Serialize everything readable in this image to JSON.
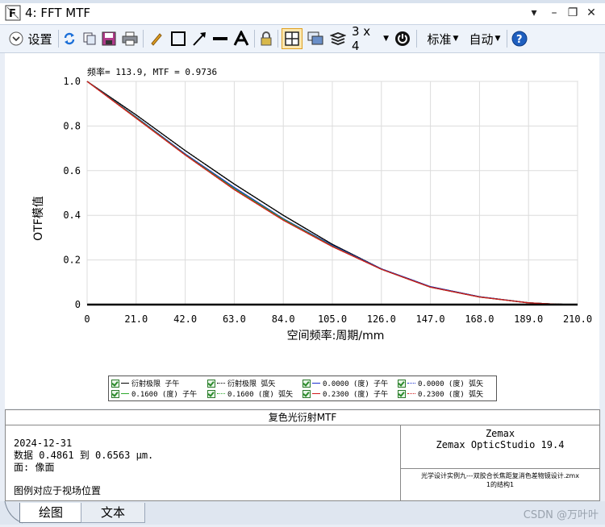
{
  "window": {
    "title": "4: FFT MTF",
    "controls": [
      "minimize",
      "restore",
      "close"
    ]
  },
  "toolbar": {
    "settings_label": "设置",
    "layout_label": "3 x 4",
    "standard_label": "标准",
    "auto_label": "自动"
  },
  "plot": {
    "cursor_readout": "频率= 113.9, MTF = 0.9736",
    "ylabel": "OTF模值",
    "xlabel": "空间频率:周期/mm"
  },
  "chart_data": {
    "type": "line",
    "xlabel": "空间频率:周期/mm",
    "ylabel": "OTF模值",
    "xlim": [
      0,
      210
    ],
    "ylim": [
      0,
      1
    ],
    "x_ticks": [
      "0",
      "21.0",
      "42.0",
      "63.0",
      "84.0",
      "105.0",
      "126.0",
      "147.0",
      "168.0",
      "189.0",
      "210.0"
    ],
    "y_ticks": [
      "0",
      "0.2",
      "0.4",
      "0.6",
      "0.8",
      "1.0"
    ],
    "grid": true,
    "x": [
      0,
      21,
      42,
      63,
      84,
      105,
      126,
      147,
      168,
      189,
      200,
      210
    ],
    "series": [
      {
        "name": "衍射极限 子午",
        "color": "#000000",
        "style": "solid",
        "values": [
          1.0,
          0.85,
          0.69,
          0.54,
          0.4,
          0.27,
          0.16,
          0.08,
          0.035,
          0.008,
          0.002,
          0.0
        ]
      },
      {
        "name": "衍射极限 弧矢",
        "color": "#000000",
        "style": "dotted",
        "values": [
          1.0,
          0.85,
          0.69,
          0.54,
          0.4,
          0.27,
          0.16,
          0.08,
          0.035,
          0.008,
          0.002,
          0.0
        ]
      },
      {
        "name": "0.0000 (度) 子午",
        "color": "#1a2fd0",
        "style": "solid",
        "values": [
          1.0,
          0.84,
          0.675,
          0.525,
          0.385,
          0.265,
          0.16,
          0.08,
          0.035,
          0.008,
          0.002,
          0.0
        ]
      },
      {
        "name": "0.0000 (度) 弧矢",
        "color": "#1a2fd0",
        "style": "dotted",
        "values": [
          1.0,
          0.84,
          0.675,
          0.525,
          0.385,
          0.265,
          0.16,
          0.08,
          0.035,
          0.008,
          0.002,
          0.0
        ]
      },
      {
        "name": "0.1600 (度) 子午",
        "color": "#2eaa2e",
        "style": "solid",
        "values": [
          1.0,
          0.838,
          0.672,
          0.52,
          0.382,
          0.262,
          0.158,
          0.078,
          0.034,
          0.008,
          0.002,
          0.0
        ]
      },
      {
        "name": "0.1600 (度) 弧矢",
        "color": "#2eaa2e",
        "style": "dotted",
        "values": [
          1.0,
          0.838,
          0.672,
          0.52,
          0.382,
          0.262,
          0.158,
          0.078,
          0.034,
          0.008,
          0.002,
          0.0
        ]
      },
      {
        "name": "0.2300 (度) 子午",
        "color": "#d01a1a",
        "style": "solid",
        "values": [
          1.0,
          0.835,
          0.67,
          0.515,
          0.378,
          0.26,
          0.158,
          0.078,
          0.034,
          0.008,
          0.002,
          0.0
        ]
      },
      {
        "name": "0.2300 (度) 弧矢",
        "color": "#d01a1a",
        "style": "dotted",
        "values": [
          1.0,
          0.835,
          0.67,
          0.515,
          0.378,
          0.26,
          0.158,
          0.078,
          0.034,
          0.008,
          0.002,
          0.0
        ]
      }
    ]
  },
  "legend": {
    "items": [
      "衍射极限 子午",
      "衍射极限 弧矢",
      "0.0000 (度) 子午",
      "0.0000 (度) 弧矢",
      "0.1600 (度) 子午",
      "0.1600 (度) 弧矢",
      "0.2300 (度) 子午",
      "0.2300 (度) 弧矢"
    ]
  },
  "info": {
    "title": "复色光衍射MTF",
    "date": "2024-12-31",
    "data_line": "数据 0.4861 到 0.6563 μm.",
    "surface_line": "面: 像面",
    "legend_note": "图例对应于视场位置",
    "company": "Zemax",
    "product": "Zemax OpticStudio 19.4",
    "file_line1": "光学设计实例九---双胶合长焦距复消色差物镜设计.zmx",
    "file_line2": "1的结构1"
  },
  "tabs": {
    "plot": "绘图",
    "text": "文本"
  },
  "watermark": "CSDN @万叶叶",
  "colors": {
    "diffraction": "#000000",
    "field0": "#1a2fd0",
    "field1": "#2eaa2e",
    "field2": "#d01a1a"
  }
}
